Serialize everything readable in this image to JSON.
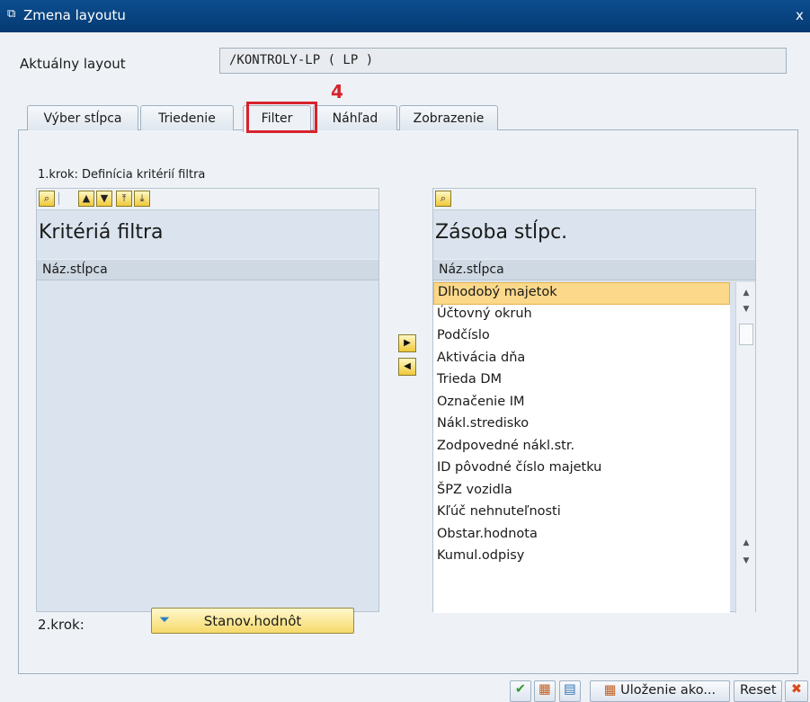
{
  "window": {
    "title": "Zmena layoutu",
    "close_glyph": "x"
  },
  "layout": {
    "label": "Aktuálny layout",
    "value": "/KONTROLY-LP ( LP )"
  },
  "annotation": {
    "step_number": "4",
    "color": "#d7232c"
  },
  "tabs": [
    {
      "label": "Výber stĺpca",
      "active": false
    },
    {
      "label": "Triedenie",
      "active": false
    },
    {
      "label": "Filter",
      "active": true
    },
    {
      "label": "Náhľad",
      "active": false
    },
    {
      "label": "Zobrazenie",
      "active": false
    }
  ],
  "step1": {
    "label": "1.krok: Definícia kritérií filtra"
  },
  "left_panel": {
    "title": "Kritériá filtra",
    "column_header": "Náz.stĺpca",
    "toolbar_icons": [
      "binoculars-icon",
      "arrow-up-icon",
      "arrow-down-icon",
      "arrow-top-icon",
      "arrow-bottom-icon"
    ]
  },
  "right_panel": {
    "title": "Zásoba stĺpc.",
    "column_header": "Náz.stĺpca",
    "items": [
      "Dlhodobý majetok",
      "Účtovný okruh",
      "Podčíslo",
      "Aktivácia dňa",
      "Trieda DM",
      "Označenie IM",
      "Nákl.stredisko",
      "Zodpovedné nákl.str.",
      "ID pôvodné číslo majetku",
      "ŠPZ vozidla",
      "Kľúč nehnuteľnosti",
      "Obstar.hodnota",
      "Kumul.odpisy"
    ],
    "selected_index": 0
  },
  "step2": {
    "label": "2.krok:",
    "button_label": "Stanov.hodnôt"
  },
  "bottom_toolbar": {
    "save_as_label": "Uloženie ako...",
    "reset_label": "Reset"
  }
}
